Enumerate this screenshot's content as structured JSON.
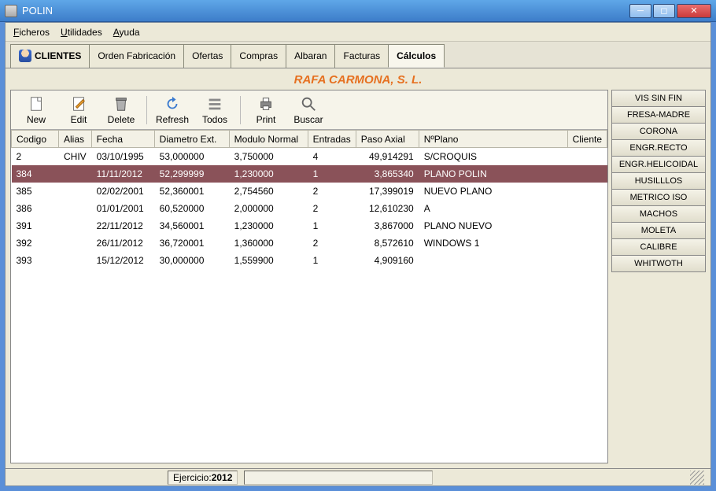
{
  "window": {
    "title": "POLIN"
  },
  "menu": {
    "ficheros": "Ficheros",
    "utilidades": "Utilidades",
    "ayuda": "Ayuda"
  },
  "tabs": {
    "clientes": "CLIENTES",
    "orden": "Orden Fabricación",
    "ofertas": "Ofertas",
    "compras": "Compras",
    "albaran": "Albaran",
    "facturas": "Facturas",
    "calculos": "Cálculos"
  },
  "company": "RAFA CARMONA, S. L.",
  "toolbar": {
    "new": "New",
    "edit": "Edit",
    "delete": "Delete",
    "refresh": "Refresh",
    "todos": "Todos",
    "print": "Print",
    "buscar": "Buscar"
  },
  "columns": {
    "codigo": "Codigo",
    "alias": "Alias",
    "fecha": "Fecha",
    "diametro": "Diametro Ext.",
    "modulo": "Modulo Normal",
    "entradas": "Entradas",
    "paso": "Paso Axial",
    "nplano": "NºPlano",
    "cliente": "Cliente"
  },
  "rows": [
    {
      "codigo": "2",
      "alias": "CHIV",
      "fecha": "03/10/1995",
      "diametro": "53,000000",
      "modulo": "3,750000",
      "entradas": "4",
      "paso": "49,914291",
      "nplano": "S/CROQUIS",
      "cliente": "",
      "selected": false
    },
    {
      "codigo": "384",
      "alias": "",
      "fecha": "11/11/2012",
      "diametro": "52,299999",
      "modulo": "1,230000",
      "entradas": "1",
      "paso": "3,865340",
      "nplano": "PLANO POLIN",
      "cliente": "",
      "selected": true
    },
    {
      "codigo": "385",
      "alias": "",
      "fecha": "02/02/2001",
      "diametro": "52,360001",
      "modulo": "2,754560",
      "entradas": "2",
      "paso": "17,399019",
      "nplano": "NUEVO PLANO",
      "cliente": "",
      "selected": false
    },
    {
      "codigo": "386",
      "alias": "",
      "fecha": "01/01/2001",
      "diametro": "60,520000",
      "modulo": "2,000000",
      "entradas": "2",
      "paso": "12,610230",
      "nplano": "A",
      "cliente": "",
      "selected": false
    },
    {
      "codigo": "391",
      "alias": "",
      "fecha": "22/11/2012",
      "diametro": "34,560001",
      "modulo": "1,230000",
      "entradas": "1",
      "paso": "3,867000",
      "nplano": "PLANO NUEVO",
      "cliente": "",
      "selected": false
    },
    {
      "codigo": "392",
      "alias": "",
      "fecha": "26/11/2012",
      "diametro": "36,720001",
      "modulo": "1,360000",
      "entradas": "2",
      "paso": "8,572610",
      "nplano": "WINDOWS 1",
      "cliente": "",
      "selected": false
    },
    {
      "codigo": "393",
      "alias": "",
      "fecha": "15/12/2012",
      "diametro": "30,000000",
      "modulo": "1,559900",
      "entradas": "1",
      "paso": "4,909160",
      "nplano": "",
      "cliente": "",
      "selected": false
    }
  ],
  "sidebar": [
    "VIS SIN FIN",
    "FRESA-MADRE",
    "CORONA",
    "ENGR.RECTO",
    "ENGR.HELICOIDAL",
    "HUSILLLOS",
    "METRICO ISO",
    "MACHOS",
    "MOLETA",
    "CALIBRE",
    "WHITWOTH"
  ],
  "status": {
    "ejercicio_label": "Ejercicio:",
    "ejercicio_value": "2012"
  }
}
